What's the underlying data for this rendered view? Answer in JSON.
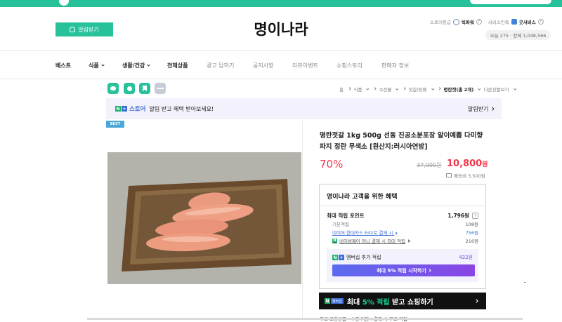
{
  "header": {
    "alarm_button": "알림받기",
    "store_name": "명이나라",
    "grade_label": "스토어등급",
    "grade_value": "빅파워",
    "service_label": "서비스만족",
    "service_value": "굿서비스",
    "visitors": "오늘 275 · 전체 1,048,566"
  },
  "nav": {
    "items": [
      {
        "label": "베스트"
      },
      {
        "label": "식품"
      },
      {
        "label": "생활/건강"
      },
      {
        "label": "전체상품"
      },
      {
        "label": "광고 답하기"
      },
      {
        "label": "공지사항"
      },
      {
        "label": "리뷰이벤트"
      },
      {
        "label": "쇼핑스토리"
      },
      {
        "label": "판매자 정보"
      }
    ]
  },
  "breadcrumb": {
    "home": "홈",
    "c1": "식품",
    "c2": "수산물",
    "c3": "젓갈/장류",
    "current": "명란젓(총 2개)",
    "more": "다른상품보기"
  },
  "banner": {
    "store_word": "스토어",
    "message": "알림 받고 혜택 받아보세요!",
    "link": "알림받기"
  },
  "product": {
    "badge": "BEST",
    "name": "명란젓갈 1kg 500g 선동 진공소분포장 알이예쁨 다미향 파지 정란 무색소 [원산지:러시아연방]",
    "discount": "70%",
    "original_price": "37,000원",
    "sale_price": "10,800",
    "sale_unit": "원",
    "shipping": "배송비 3,500원"
  },
  "benefits": {
    "title": "명이나라 고객을 위한 혜택",
    "max_point_label": "최대 적립 포인트",
    "max_point_value": "1,796원",
    "basic_label": "기본적립",
    "basic_value": "108원",
    "card_label": "네이버 현대카드 Ed2로 결제 시",
    "card_value": "756원",
    "money_label": "네이버페이 머니 결제 시 최대 적립",
    "money_value": "216원",
    "member_label": "멤버십 추가 적립",
    "member_value": "432원",
    "member_button": "최대 5% 적립 시작하기"
  },
  "black_banner": {
    "badge": "멤버십",
    "text_pre": "최대 ",
    "text_hl": "5% 적립",
    "text_post": " 받고 쇼핑하기"
  },
  "bottom_text": "무료 교환반품 - 수령 기간 : 결제 시 무료 적립"
}
